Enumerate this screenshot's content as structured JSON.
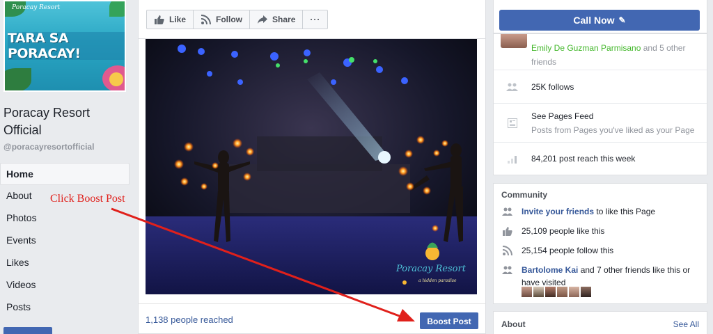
{
  "page": {
    "cover_brand": "Poracay Resort",
    "cover_tagline": "a hidden paradise",
    "cover_banner": "TARA SA PORACAY!",
    "name": "Poracay Resort Official",
    "handle": "@poracayresortofficial"
  },
  "nav": {
    "items": [
      {
        "label": "Home"
      },
      {
        "label": "About"
      },
      {
        "label": "Photos"
      },
      {
        "label": "Events"
      },
      {
        "label": "Likes"
      },
      {
        "label": "Videos"
      },
      {
        "label": "Posts"
      }
    ]
  },
  "annotation": {
    "text": "Click Boost Post",
    "color": "#e0201b"
  },
  "actions": {
    "like": "Like",
    "follow": "Follow",
    "share": "Share",
    "more": "···"
  },
  "post": {
    "watermark_brand": "Poracay Resort",
    "watermark_tagline": "a hidden paradise",
    "reach": "1,138 people reached",
    "boost_label": "Boost Post"
  },
  "sidebar": {
    "call_now": "Call Now",
    "friend_name": "Emily De Guzman Parmisano",
    "friend_rest": " and 5 other friends",
    "follows": "25K follows",
    "pages_feed_title": "See Pages Feed",
    "pages_feed_sub": "Posts from Pages you've liked as your Page",
    "post_reach": "84,201 post reach this week"
  },
  "community": {
    "title": "Community",
    "invite_link": "Invite your friends",
    "invite_rest": " to like this Page",
    "likes": "25,109 people like this",
    "follows": "25,154 people follow this",
    "friend_name": "Bartolome Kai",
    "friend_rest": " and 7 other friends like this or have visited"
  },
  "about": {
    "title": "About",
    "see_all": "See All"
  },
  "colors": {
    "brand_blue": "#4267b2",
    "link_blue": "#365899",
    "green": "#42b72a",
    "background": "#e9ebee"
  }
}
